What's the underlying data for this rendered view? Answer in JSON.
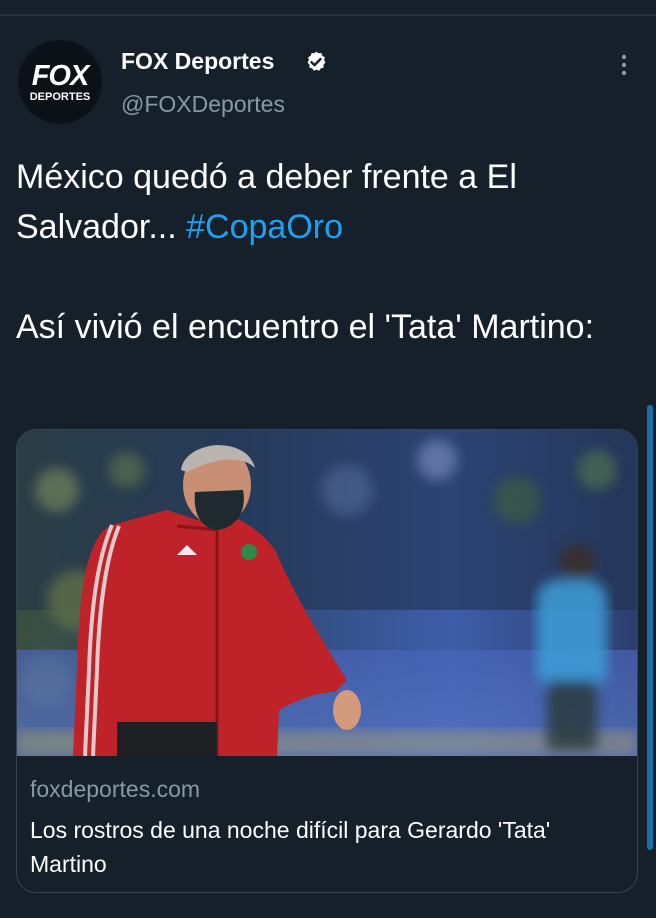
{
  "author": {
    "display_name": "FOX Deportes",
    "handle": "@FOXDeportes",
    "avatar_logo_top": "FOX",
    "avatar_logo_bottom": "DEPORTES",
    "verified": true
  },
  "tweet": {
    "line1_text": "México quedó a deber frente a El Salvador... ",
    "hashtag": "#CopaOro",
    "line2_text": "Así vivió el encuentro el 'Tata' Martino:"
  },
  "card": {
    "domain": "foxdeportes.com",
    "title": "Los rostros de una noche difícil para Gerardo 'Tata' Martino"
  },
  "colors": {
    "background": "#15202b",
    "link": "#1da1f2",
    "secondary_text": "#8899a6",
    "jacket": "#c0222a"
  },
  "icons": {
    "verified": "verified-badge-icon",
    "more": "more-options-icon"
  }
}
